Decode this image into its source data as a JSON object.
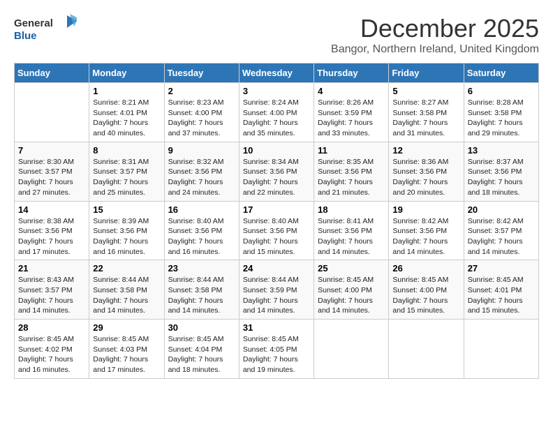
{
  "logo": {
    "general": "General",
    "blue": "Blue"
  },
  "title": "December 2025",
  "location": "Bangor, Northern Ireland, United Kingdom",
  "days_header": [
    "Sunday",
    "Monday",
    "Tuesday",
    "Wednesday",
    "Thursday",
    "Friday",
    "Saturday"
  ],
  "weeks": [
    [
      {
        "day": "",
        "sunrise": "",
        "sunset": "",
        "daylight": ""
      },
      {
        "day": "1",
        "sunrise": "Sunrise: 8:21 AM",
        "sunset": "Sunset: 4:01 PM",
        "daylight": "Daylight: 7 hours and 40 minutes."
      },
      {
        "day": "2",
        "sunrise": "Sunrise: 8:23 AM",
        "sunset": "Sunset: 4:00 PM",
        "daylight": "Daylight: 7 hours and 37 minutes."
      },
      {
        "day": "3",
        "sunrise": "Sunrise: 8:24 AM",
        "sunset": "Sunset: 4:00 PM",
        "daylight": "Daylight: 7 hours and 35 minutes."
      },
      {
        "day": "4",
        "sunrise": "Sunrise: 8:26 AM",
        "sunset": "Sunset: 3:59 PM",
        "daylight": "Daylight: 7 hours and 33 minutes."
      },
      {
        "day": "5",
        "sunrise": "Sunrise: 8:27 AM",
        "sunset": "Sunset: 3:58 PM",
        "daylight": "Daylight: 7 hours and 31 minutes."
      },
      {
        "day": "6",
        "sunrise": "Sunrise: 8:28 AM",
        "sunset": "Sunset: 3:58 PM",
        "daylight": "Daylight: 7 hours and 29 minutes."
      }
    ],
    [
      {
        "day": "7",
        "sunrise": "Sunrise: 8:30 AM",
        "sunset": "Sunset: 3:57 PM",
        "daylight": "Daylight: 7 hours and 27 minutes."
      },
      {
        "day": "8",
        "sunrise": "Sunrise: 8:31 AM",
        "sunset": "Sunset: 3:57 PM",
        "daylight": "Daylight: 7 hours and 25 minutes."
      },
      {
        "day": "9",
        "sunrise": "Sunrise: 8:32 AM",
        "sunset": "Sunset: 3:56 PM",
        "daylight": "Daylight: 7 hours and 24 minutes."
      },
      {
        "day": "10",
        "sunrise": "Sunrise: 8:34 AM",
        "sunset": "Sunset: 3:56 PM",
        "daylight": "Daylight: 7 hours and 22 minutes."
      },
      {
        "day": "11",
        "sunrise": "Sunrise: 8:35 AM",
        "sunset": "Sunset: 3:56 PM",
        "daylight": "Daylight: 7 hours and 21 minutes."
      },
      {
        "day": "12",
        "sunrise": "Sunrise: 8:36 AM",
        "sunset": "Sunset: 3:56 PM",
        "daylight": "Daylight: 7 hours and 20 minutes."
      },
      {
        "day": "13",
        "sunrise": "Sunrise: 8:37 AM",
        "sunset": "Sunset: 3:56 PM",
        "daylight": "Daylight: 7 hours and 18 minutes."
      }
    ],
    [
      {
        "day": "14",
        "sunrise": "Sunrise: 8:38 AM",
        "sunset": "Sunset: 3:56 PM",
        "daylight": "Daylight: 7 hours and 17 minutes."
      },
      {
        "day": "15",
        "sunrise": "Sunrise: 8:39 AM",
        "sunset": "Sunset: 3:56 PM",
        "daylight": "Daylight: 7 hours and 16 minutes."
      },
      {
        "day": "16",
        "sunrise": "Sunrise: 8:40 AM",
        "sunset": "Sunset: 3:56 PM",
        "daylight": "Daylight: 7 hours and 16 minutes."
      },
      {
        "day": "17",
        "sunrise": "Sunrise: 8:40 AM",
        "sunset": "Sunset: 3:56 PM",
        "daylight": "Daylight: 7 hours and 15 minutes."
      },
      {
        "day": "18",
        "sunrise": "Sunrise: 8:41 AM",
        "sunset": "Sunset: 3:56 PM",
        "daylight": "Daylight: 7 hours and 14 minutes."
      },
      {
        "day": "19",
        "sunrise": "Sunrise: 8:42 AM",
        "sunset": "Sunset: 3:56 PM",
        "daylight": "Daylight: 7 hours and 14 minutes."
      },
      {
        "day": "20",
        "sunrise": "Sunrise: 8:42 AM",
        "sunset": "Sunset: 3:57 PM",
        "daylight": "Daylight: 7 hours and 14 minutes."
      }
    ],
    [
      {
        "day": "21",
        "sunrise": "Sunrise: 8:43 AM",
        "sunset": "Sunset: 3:57 PM",
        "daylight": "Daylight: 7 hours and 14 minutes."
      },
      {
        "day": "22",
        "sunrise": "Sunrise: 8:44 AM",
        "sunset": "Sunset: 3:58 PM",
        "daylight": "Daylight: 7 hours and 14 minutes."
      },
      {
        "day": "23",
        "sunrise": "Sunrise: 8:44 AM",
        "sunset": "Sunset: 3:58 PM",
        "daylight": "Daylight: 7 hours and 14 minutes."
      },
      {
        "day": "24",
        "sunrise": "Sunrise: 8:44 AM",
        "sunset": "Sunset: 3:59 PM",
        "daylight": "Daylight: 7 hours and 14 minutes."
      },
      {
        "day": "25",
        "sunrise": "Sunrise: 8:45 AM",
        "sunset": "Sunset: 4:00 PM",
        "daylight": "Daylight: 7 hours and 14 minutes."
      },
      {
        "day": "26",
        "sunrise": "Sunrise: 8:45 AM",
        "sunset": "Sunset: 4:00 PM",
        "daylight": "Daylight: 7 hours and 15 minutes."
      },
      {
        "day": "27",
        "sunrise": "Sunrise: 8:45 AM",
        "sunset": "Sunset: 4:01 PM",
        "daylight": "Daylight: 7 hours and 15 minutes."
      }
    ],
    [
      {
        "day": "28",
        "sunrise": "Sunrise: 8:45 AM",
        "sunset": "Sunset: 4:02 PM",
        "daylight": "Daylight: 7 hours and 16 minutes."
      },
      {
        "day": "29",
        "sunrise": "Sunrise: 8:45 AM",
        "sunset": "Sunset: 4:03 PM",
        "daylight": "Daylight: 7 hours and 17 minutes."
      },
      {
        "day": "30",
        "sunrise": "Sunrise: 8:45 AM",
        "sunset": "Sunset: 4:04 PM",
        "daylight": "Daylight: 7 hours and 18 minutes."
      },
      {
        "day": "31",
        "sunrise": "Sunrise: 8:45 AM",
        "sunset": "Sunset: 4:05 PM",
        "daylight": "Daylight: 7 hours and 19 minutes."
      },
      {
        "day": "",
        "sunrise": "",
        "sunset": "",
        "daylight": ""
      },
      {
        "day": "",
        "sunrise": "",
        "sunset": "",
        "daylight": ""
      },
      {
        "day": "",
        "sunrise": "",
        "sunset": "",
        "daylight": ""
      }
    ]
  ]
}
